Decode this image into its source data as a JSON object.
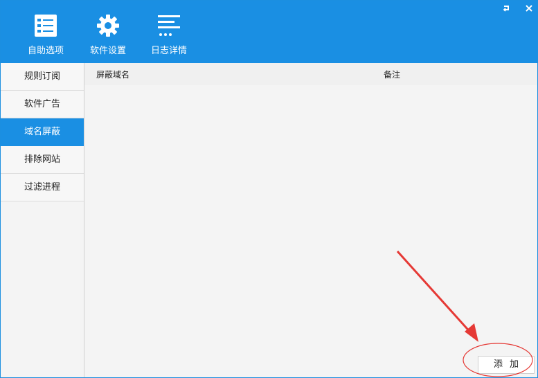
{
  "window": {
    "restore_icon": "restore-icon",
    "close_icon": "close-icon"
  },
  "toolbar": {
    "items": [
      {
        "label": "自助选项",
        "icon": "checklist-icon"
      },
      {
        "label": "软件设置",
        "icon": "gear-icon"
      },
      {
        "label": "日志详情",
        "icon": "log-lines-icon"
      }
    ]
  },
  "sidebar": {
    "items": [
      {
        "label": "规则订阅",
        "active": false
      },
      {
        "label": "软件广告",
        "active": false
      },
      {
        "label": "域名屏蔽",
        "active": true
      },
      {
        "label": "排除网站",
        "active": false
      },
      {
        "label": "过滤进程",
        "active": false
      }
    ]
  },
  "table": {
    "columns": [
      "屏蔽域名",
      "备注"
    ],
    "rows": []
  },
  "actions": {
    "add_label": "添加"
  },
  "colors": {
    "accent": "#1a8fe3",
    "annotation": "#e53935"
  }
}
